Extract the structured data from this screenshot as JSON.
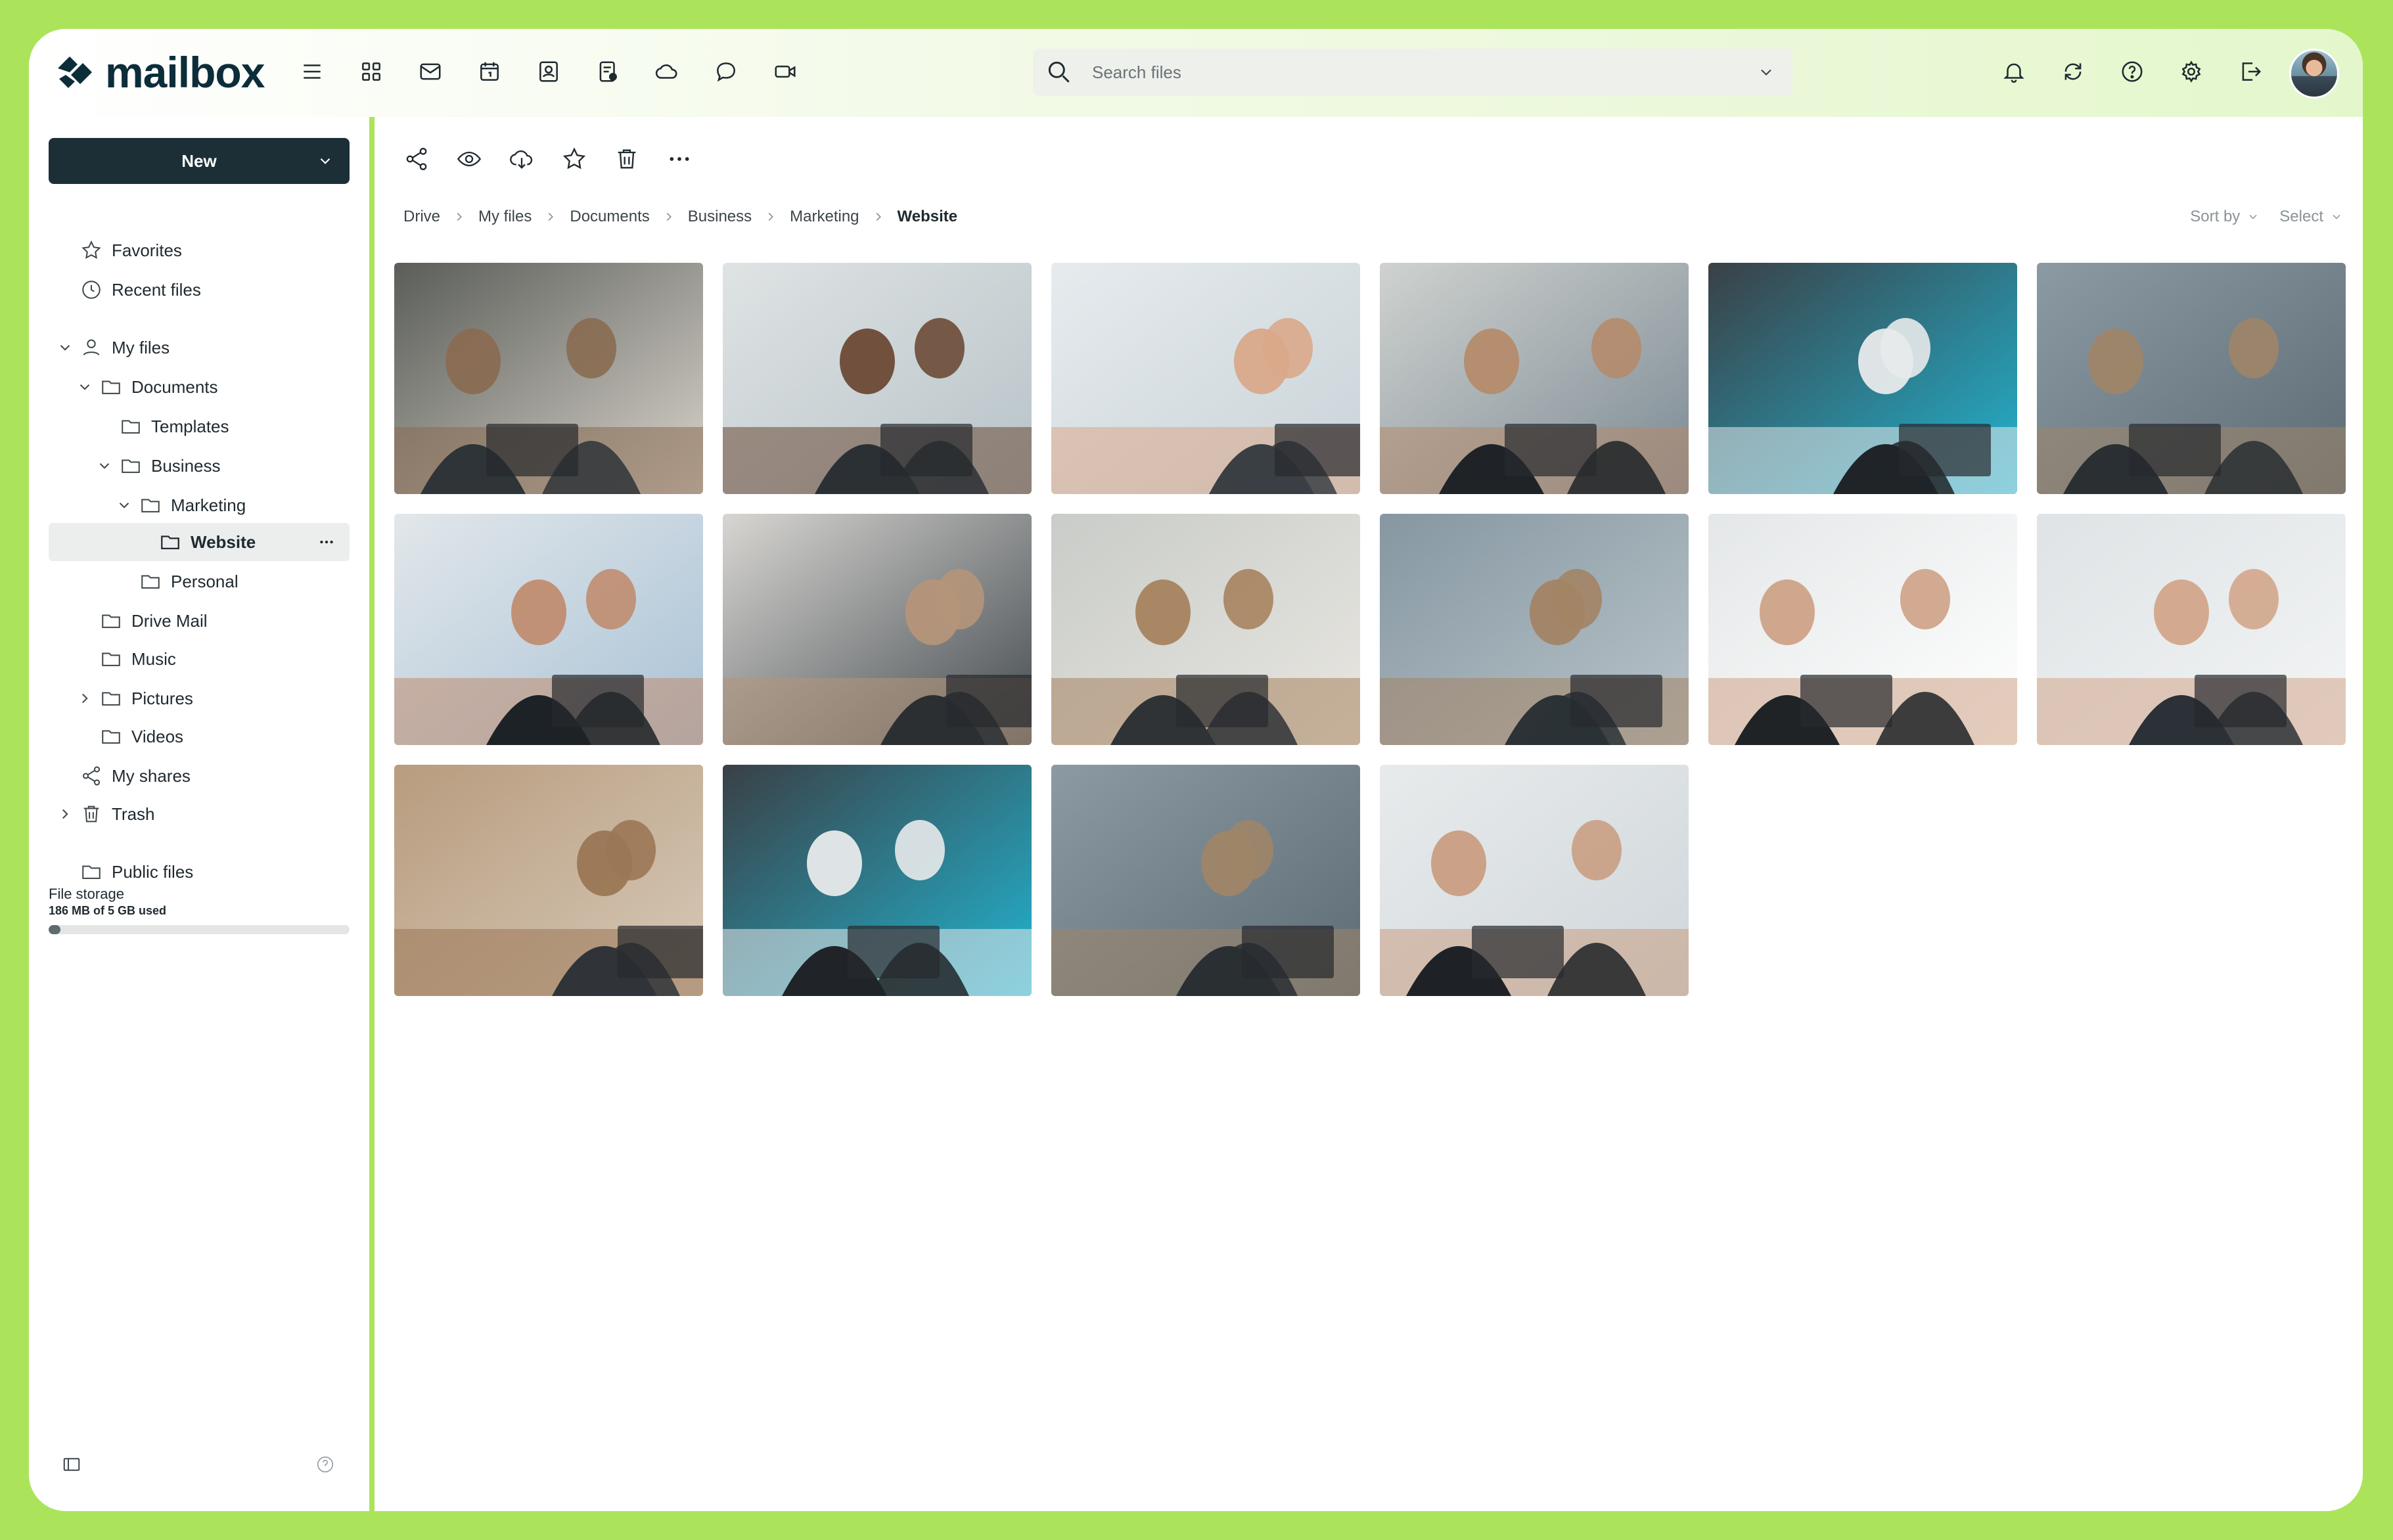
{
  "app": {
    "name": "mailbox"
  },
  "search": {
    "placeholder": "Search files"
  },
  "sidebar": {
    "new_label": "New",
    "items": [
      {
        "label": "Favorites",
        "icon": "star-icon"
      },
      {
        "label": "Recent files",
        "icon": "clock-icon"
      },
      {
        "label": "My files",
        "icon": "user-icon"
      },
      {
        "label": "Documents",
        "icon": "folder-icon"
      },
      {
        "label": "Templates",
        "icon": "folder-icon"
      },
      {
        "label": "Business",
        "icon": "folder-icon"
      },
      {
        "label": "Marketing",
        "icon": "folder-icon"
      },
      {
        "label": "Website",
        "icon": "folder-icon"
      },
      {
        "label": "Personal",
        "icon": "folder-icon"
      },
      {
        "label": "Drive Mail",
        "icon": "folder-icon"
      },
      {
        "label": "Music",
        "icon": "folder-icon"
      },
      {
        "label": "Pictures",
        "icon": "folder-icon"
      },
      {
        "label": "Videos",
        "icon": "folder-icon"
      },
      {
        "label": "My shares",
        "icon": "share-icon"
      },
      {
        "label": "Trash",
        "icon": "trash-icon"
      },
      {
        "label": "Public files",
        "icon": "folder-icon"
      }
    ],
    "storage": {
      "label": "File storage",
      "used": "186 MB of 5 GB used",
      "fraction": 0.04
    }
  },
  "breadcrumb": [
    "Drive",
    "My files",
    "Documents",
    "Business",
    "Marketing",
    "Website"
  ],
  "sort_label": "Sort by",
  "select_label": "Select",
  "photo_count": 16,
  "colors": {
    "accent": "#abe45a",
    "dark": "#1c2f37"
  }
}
